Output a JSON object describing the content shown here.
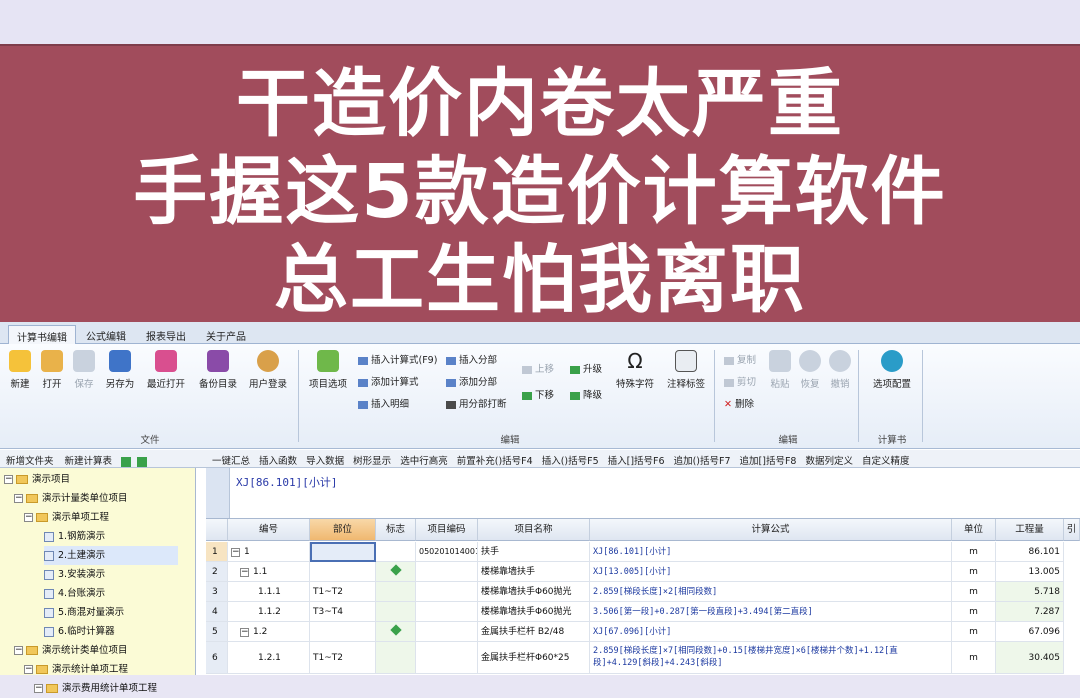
{
  "banner": {
    "line1": "干造价内卷太严重",
    "line2": "手握这5款造价计算软件",
    "line3": "总工生怕我离职"
  },
  "menubar": {
    "tabs": [
      "计算书编辑",
      "公式编辑",
      "报表导出",
      "关于产品"
    ]
  },
  "ribbon": {
    "file": {
      "new": "新建",
      "open": "打开",
      "save": "保存",
      "save_as": "另存为",
      "recent": "最近打开",
      "backup": "备份目录",
      "user_login": "用户登录",
      "group": "文件"
    },
    "edit": {
      "item_options": "项目选项",
      "insert_formula": "插入计算式(F9)",
      "add_formula": "添加计算式",
      "insert_detail": "插入明细",
      "insert_part": "插入分部",
      "add_part": "添加分部",
      "part_print": "用分部打断",
      "move_up": "上移",
      "move_down": "下移",
      "upgrade": "升级",
      "downgrade": "降级",
      "special_char": "特殊字符",
      "annotation": "注释标签",
      "group": "编辑"
    },
    "clipboard": {
      "copy": "复制",
      "cut": "剪切",
      "delete": "删除",
      "paste": "粘贴",
      "restore": "恢复",
      "undo": "撤销",
      "group": "编辑"
    },
    "calc": {
      "options_config": "选项配置",
      "group": "计算书"
    }
  },
  "left_toolbar": {
    "new_folder": "新增文件夹",
    "new_sheet": "新建计算表"
  },
  "main_toolbar": {
    "items": [
      "一键汇总",
      "插入函数",
      "导入数据",
      "树形显示",
      "选中行高亮",
      "前置补充()括号F4",
      "插入()括号F5",
      "插入[]括号F6",
      "追加()括号F7",
      "追加[]括号F8",
      "数据列定义",
      "自定义精度"
    ]
  },
  "tree": {
    "items": [
      "演示项目",
      "演示计量类单位项目",
      "演示单项工程",
      "1.钢筋演示",
      "2.土建演示",
      "3.安装演示",
      "4.台账演示",
      "5.商混对量演示",
      "6.临时计算器",
      "演示统计类单位项目",
      "演示统计单项工程",
      "演示费用统计单项工程"
    ]
  },
  "formula_bar": {
    "text": "XJ[86.101][小计]"
  },
  "grid": {
    "headers": [
      "编号",
      "部位",
      "标志",
      "项目编码",
      "项目名称",
      "计算公式",
      "单位",
      "工程量",
      "引"
    ],
    "rows": [
      {
        "n": "1",
        "code": "1",
        "part": "",
        "item_code": "050201014001",
        "name": "扶手",
        "formula": "XJ[86.101][小计]",
        "unit": "m",
        "qty": "86.101"
      },
      {
        "n": "2",
        "code": "1.1",
        "part": "",
        "item_code": "",
        "name": "楼梯靠墙扶手",
        "formula": "XJ[13.005][小计]",
        "unit": "m",
        "qty": "13.005"
      },
      {
        "n": "3",
        "code": "1.1.1",
        "part": "T1~T2",
        "item_code": "",
        "name": "楼梯靠墙扶手Φ60抛光",
        "formula": "2.859[梯段长度]×2[相同段数]",
        "unit": "m",
        "qty": "5.718"
      },
      {
        "n": "4",
        "code": "1.1.2",
        "part": "T3~T4",
        "item_code": "",
        "name": "楼梯靠墙扶手Φ60抛光",
        "formula": "3.506[第一段]+0.287[第一段直段]+3.494[第二直段]",
        "unit": "m",
        "qty": "7.287"
      },
      {
        "n": "5",
        "code": "1.2",
        "part": "",
        "item_code": "",
        "name": "金属扶手栏杆 B2/48",
        "formula": "XJ[67.096][小计]",
        "unit": "m",
        "qty": "67.096"
      },
      {
        "n": "6",
        "code": "1.2.1",
        "part": "T1~T2",
        "item_code": "",
        "name": "金属扶手栏杆Φ60*25",
        "formula": "2.859[梯段长度]×7[相同段数]+0.15[楼梯井宽度]×6[楼梯井个数]+1.12[直段]+4.129[斜段]+4.243[斜段]",
        "unit": "m",
        "qty": "30.405"
      }
    ]
  },
  "colors": {
    "banner": "#a14c5c",
    "tree_bg": "#fbfbd6",
    "header_hl": "#f0b870"
  }
}
